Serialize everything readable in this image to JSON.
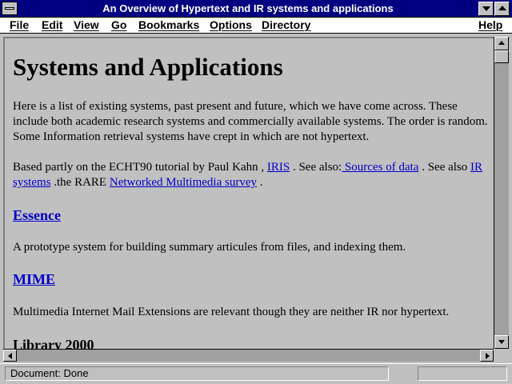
{
  "window": {
    "title": "An Overview of Hypertext and IR systems and applications"
  },
  "menu": [
    {
      "label": "File"
    },
    {
      "label": "Edit"
    },
    {
      "label": "View"
    },
    {
      "label": "Go"
    },
    {
      "label": "Bookmarks"
    },
    {
      "label": "Options"
    },
    {
      "label": "Directory"
    },
    {
      "label": "Help"
    }
  ],
  "document": {
    "heading": "Systems and Applications",
    "intro": "Here is a list of existing systems, past present and future, which we have come across. These include both academic research systems and commercially available systems. The order is random. Some Information retrieval systems have crept in which are not hypertext.",
    "based": {
      "t1": "Based partly on the ECHT90 tutorial by Paul Kahn , ",
      "link_iris": "IRIS",
      "t2": " . See also:",
      "link_sources": " Sources of data",
      "t3": " . See also ",
      "link_ir": "IR systems",
      "t4": " .the RARE ",
      "link_networked": "Networked Multimedia survey",
      "t5": " ."
    },
    "sections": [
      {
        "title": "Essence",
        "text": "A prototype system for building summary articules from files, and indexing them."
      },
      {
        "title": "MIME",
        "text": "Multimedia Internet Mail Extensions are relevant though they are neither IR nor hypertext."
      },
      {
        "title": "Library 2000"
      }
    ]
  },
  "status": {
    "text": "Document: Done"
  },
  "colors": {
    "titlebar": "#000080",
    "link": "#0000cc",
    "background": "#c0c0c0"
  }
}
